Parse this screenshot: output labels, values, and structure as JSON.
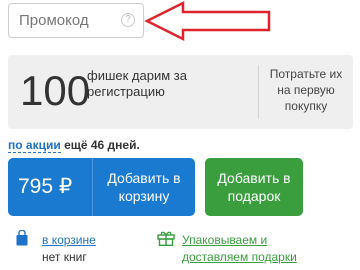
{
  "promo": {
    "placeholder": "Промокод",
    "help_icon": "question-circle-icon"
  },
  "bonus": {
    "number": "100",
    "description": "фишек дарим за регистрацию",
    "spend_text": "Потратьте их на первую покупку"
  },
  "promotion": {
    "link_text": "по акции",
    "days_text": " ещё 46 дней."
  },
  "buy_button": {
    "price": "795 ₽",
    "label": "Добавить в корзину"
  },
  "gift_button": {
    "label": "Добавить в подарок"
  },
  "cart": {
    "icon": "shopping-bag-icon",
    "link_text": "в корзине",
    "status": "нет книг"
  },
  "gift_wrap": {
    "icon": "gift-box-icon",
    "link_text": "Упаковываем и доставляем подарки"
  },
  "colors": {
    "primary_blue": "#1a7ad0",
    "green": "#3a9e3f",
    "link_blue": "#1e72c8",
    "arrow_red": "#e0242e",
    "panel_gray": "#efefef"
  }
}
